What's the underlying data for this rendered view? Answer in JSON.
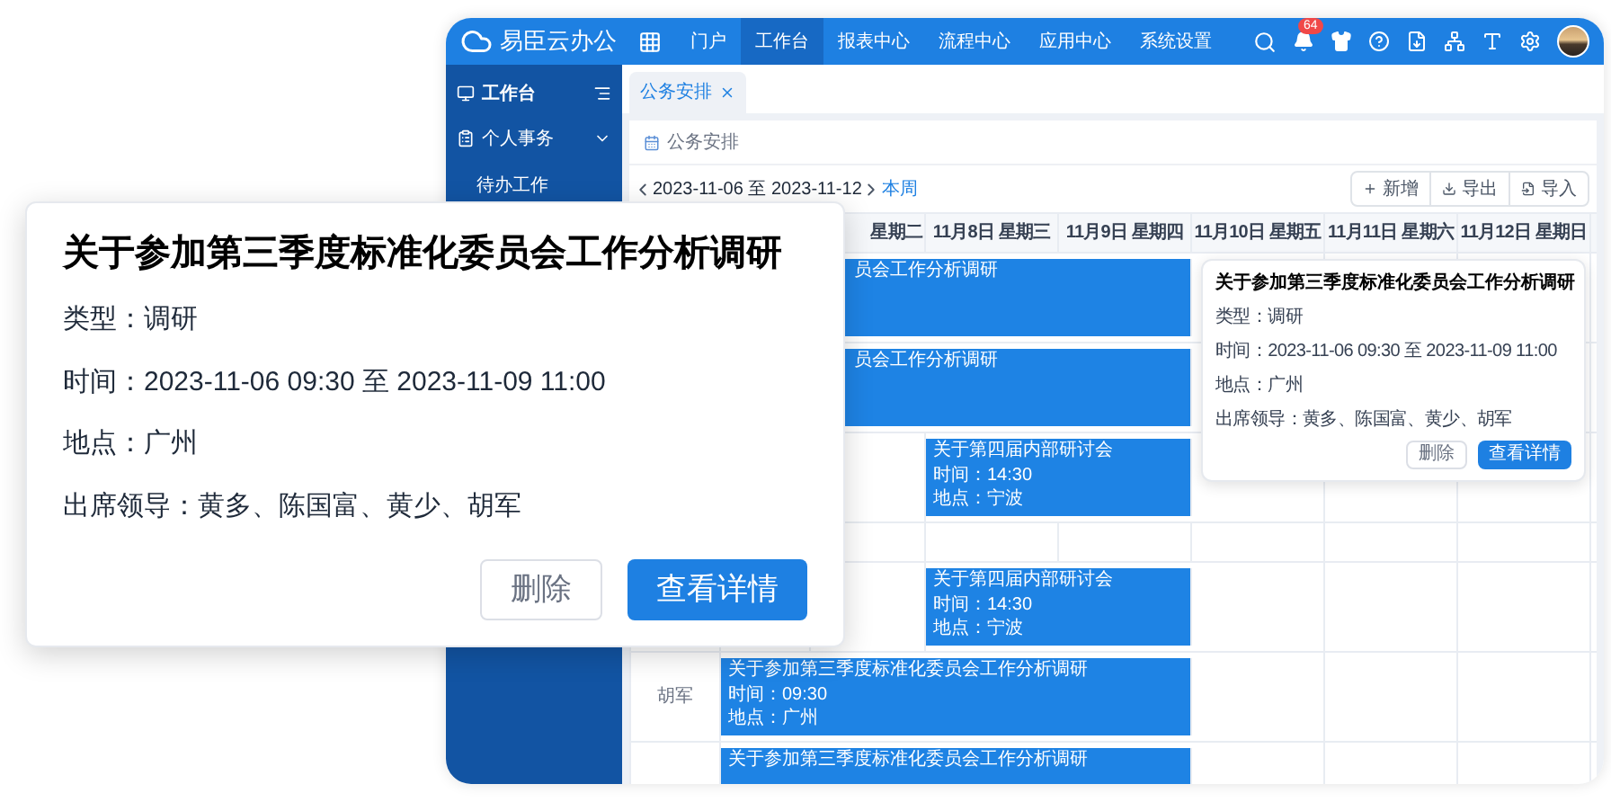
{
  "app": {
    "name": "易臣云办公"
  },
  "nav": [
    {
      "label": "门户",
      "selected": false
    },
    {
      "label": "工作台",
      "selected": true
    },
    {
      "label": "报表中心",
      "selected": false
    },
    {
      "label": "流程中心",
      "selected": false
    },
    {
      "label": "应用中心",
      "selected": false
    },
    {
      "label": "系统设置",
      "selected": false
    }
  ],
  "notifications": {
    "badge": "64"
  },
  "sidebar": {
    "items": [
      {
        "label": "工作台",
        "kind": "header"
      },
      {
        "label": "个人事务",
        "kind": "group",
        "expanded": true,
        "children": [
          {
            "label": "待办工作"
          }
        ]
      }
    ]
  },
  "tabs": [
    {
      "label": "公务安排",
      "selected": true
    }
  ],
  "breadcrumb": "公务安排",
  "toolbar": {
    "range": "2023-11-06 至 2023-11-12",
    "current_week": "本周",
    "buttons": [
      {
        "label": "新增",
        "kind": "add"
      },
      {
        "label": "导出",
        "kind": "export"
      },
      {
        "label": "导入",
        "kind": "import"
      }
    ]
  },
  "table": {
    "columns": [
      "星期二",
      "11月8日 星期三",
      "11月9日 星期四",
      "11月10日 星期五",
      "11月11日 星期六",
      "11月12日 星期日"
    ],
    "rows": [
      {
        "cells": [
          {
            "kind": "event",
            "covered": true,
            "title": "员会工作分析调研"
          },
          {
            "kind": "continued"
          },
          {
            "kind": "continued"
          },
          {
            "kind": "continued"
          },
          {
            "kind": "empty"
          },
          {
            "kind": "empty"
          },
          {
            "kind": "empty"
          }
        ]
      },
      {
        "cells": [
          {
            "kind": "event",
            "covered": true,
            "title": "员会工作分析调研"
          },
          {
            "kind": "continued"
          },
          {
            "kind": "continued"
          },
          {
            "kind": "continued"
          },
          {
            "kind": "empty"
          },
          {
            "kind": "empty"
          },
          {
            "kind": "empty"
          }
        ]
      },
      {
        "cells": [
          {
            "kind": "empty"
          },
          {
            "kind": "empty"
          },
          {
            "kind": "event",
            "covered": false,
            "title": "关于第四届内部研讨会",
            "time": "时间：14:30",
            "place": "地点：宁波"
          },
          {
            "kind": "continued"
          },
          {
            "kind": "empty"
          },
          {
            "kind": "empty"
          },
          {
            "kind": "empty"
          }
        ]
      },
      {
        "cells": [
          {
            "kind": "empty"
          },
          {
            "kind": "empty"
          },
          {
            "kind": "empty"
          },
          {
            "kind": "empty"
          },
          {
            "kind": "empty"
          },
          {
            "kind": "empty"
          },
          {
            "kind": "empty"
          }
        ]
      },
      {
        "cells": [
          {
            "kind": "empty"
          },
          {
            "kind": "empty"
          },
          {
            "kind": "event",
            "covered": false,
            "title": "关于第四届内部研讨会",
            "time": "时间：14:30",
            "place": "地点：宁波"
          },
          {
            "kind": "continued"
          },
          {
            "kind": "empty"
          },
          {
            "kind": "empty"
          },
          {
            "kind": "empty"
          }
        ]
      },
      {
        "leader": "胡军",
        "cells": [
          {
            "kind": "event",
            "covered": false,
            "title": "关于参加第三季度标准化委员会工作分析调研",
            "time": "时间：09:30",
            "place": "地点：广州"
          },
          {
            "kind": "continued"
          },
          {
            "kind": "continued"
          },
          {
            "kind": "continued"
          },
          {
            "kind": "empty"
          },
          {
            "kind": "empty"
          },
          {
            "kind": "empty"
          }
        ]
      },
      {
        "cells": [
          {
            "kind": "event",
            "covered": false,
            "title": "关于参加第三季度标准化委员会工作分析调研"
          },
          {
            "kind": "continued"
          },
          {
            "kind": "continued"
          },
          {
            "kind": "continued"
          },
          {
            "kind": "empty"
          },
          {
            "kind": "empty"
          },
          {
            "kind": "empty"
          }
        ]
      }
    ]
  },
  "popover_enlarged": {
    "title": "关于参加第三季度标准化委员会工作分析调研",
    "lines": [
      "类型：调研",
      "时间：2023-11-06 09:30 至 2023-11-09 11:00",
      "地点：广州",
      "出席领导：黄多、陈国富、黄少、胡军"
    ],
    "buttons": [
      {
        "label": "删除",
        "kind": "secondary"
      },
      {
        "label": "查看详情",
        "kind": "primary"
      }
    ]
  },
  "popover": {
    "title": "关于参加第三季度标准化委员会工作分析调研",
    "lines": [
      "类型：调研",
      "时间：2023-11-06 09:30 至 2023-11-09 11:00",
      "地点：广州",
      "出席领导：黄多、陈国富、黄少、胡军"
    ],
    "buttons": [
      {
        "label": "删除",
        "kind": "secondary"
      },
      {
        "label": "查看详情",
        "kind": "primary"
      }
    ]
  }
}
